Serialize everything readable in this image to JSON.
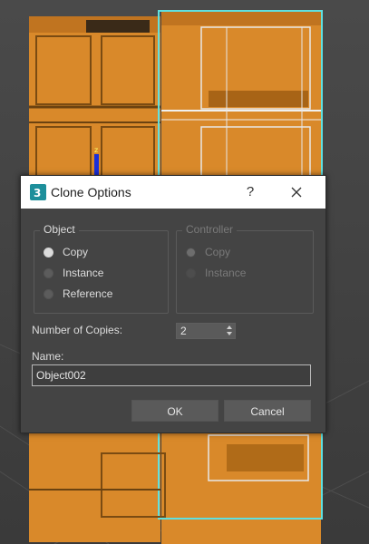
{
  "dialog": {
    "title": "Clone Options",
    "help_label": "?",
    "icon": "3dsmax-app-icon",
    "object_group": {
      "label": "Object",
      "options": [
        "Copy",
        "Instance",
        "Reference"
      ],
      "selected": "Copy"
    },
    "controller_group": {
      "label": "Controller",
      "options": [
        "Copy",
        "Instance"
      ],
      "selected": "Copy",
      "disabled": true
    },
    "copies": {
      "label": "Number of Copies:",
      "value": "2"
    },
    "name": {
      "label": "Name:",
      "value": "Object002"
    },
    "ok_label": "OK",
    "cancel_label": "Cancel"
  },
  "colors": {
    "dialog_bg": "#444444",
    "titlebar_bg": "#ffffff",
    "object_orange": "#d8892b",
    "selection_cyan": "#5fe0e0"
  }
}
